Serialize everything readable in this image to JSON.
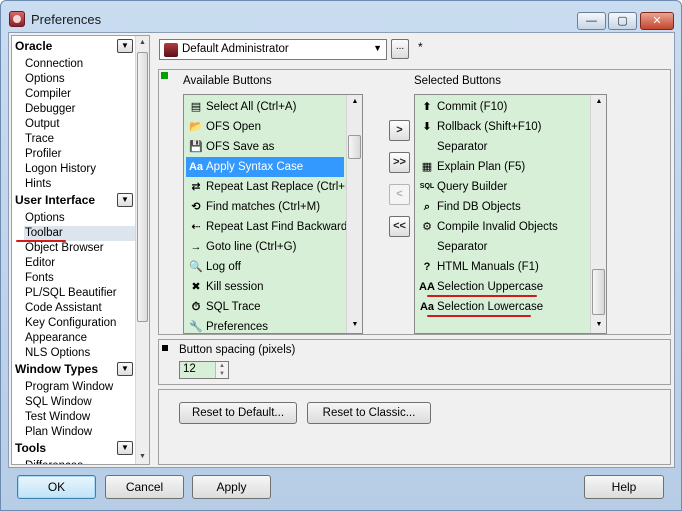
{
  "window": {
    "title": "Preferences",
    "min_glyph": "—",
    "max_glyph": "▢",
    "close_glyph": "✕"
  },
  "nav": {
    "groups": [
      {
        "label": "Oracle",
        "items": [
          "Connection",
          "Options",
          "Compiler",
          "Debugger",
          "Output",
          "Trace",
          "Profiler",
          "Logon History",
          "Hints"
        ]
      },
      {
        "label": "User Interface",
        "items": [
          "Options",
          "Toolbar",
          "Object Browser",
          "Editor",
          "Fonts",
          "PL/SQL Beautifier",
          "Code Assistant",
          "Key Configuration",
          "Appearance",
          "NLS Options"
        ]
      },
      {
        "label": "Window Types",
        "items": [
          "Program Window",
          "SQL Window",
          "Test Window",
          "Plan Window"
        ]
      },
      {
        "label": "Tools",
        "items": [
          "Differences"
        ]
      }
    ],
    "selected": "Toolbar"
  },
  "profile": {
    "value": "Default Administrator",
    "modified_marker": "*",
    "ellipsis": "..."
  },
  "toolbar_panel": {
    "available_label": "Available Buttons",
    "selected_label": "Selected Buttons",
    "available": [
      {
        "label": "Select All (Ctrl+A)",
        "icon": "page-icon",
        "glyph": "▤"
      },
      {
        "label": "OFS Open",
        "icon": "folder-open-icon",
        "glyph": "📂"
      },
      {
        "label": "OFS Save as",
        "icon": "floppy-icon",
        "glyph": "💾"
      },
      {
        "label": "Apply Syntax Case",
        "icon": "syntax-case-icon",
        "glyph": "Aa"
      },
      {
        "label": "Repeat Last Replace (Ctrl+P)",
        "icon": "replace-icon",
        "glyph": "⇄"
      },
      {
        "label": "Find matches (Ctrl+M)",
        "icon": "match-icon",
        "glyph": "⟲"
      },
      {
        "label": "Repeat Last Find Backwards (S",
        "icon": "find-back-icon",
        "glyph": "⇠"
      },
      {
        "label": "Goto line (Ctrl+G)",
        "icon": "goto-line-icon",
        "glyph": "→"
      },
      {
        "label": "Log off",
        "icon": "log-off-icon",
        "glyph": "🔍"
      },
      {
        "label": "Kill session",
        "icon": "kill-session-icon",
        "glyph": "✖"
      },
      {
        "label": "SQL Trace",
        "icon": "stopwatch-icon",
        "glyph": "⏱"
      },
      {
        "label": "Preferences",
        "icon": "wrench-icon",
        "glyph": "🔧"
      }
    ],
    "selected": [
      {
        "label": "Commit (F10)",
        "icon": "commit-icon",
        "glyph": "⬆"
      },
      {
        "label": "Rollback (Shift+F10)",
        "icon": "rollback-icon",
        "glyph": "⬇"
      },
      {
        "label": "Separator",
        "icon": "",
        "glyph": ""
      },
      {
        "label": "Explain Plan (F5)",
        "icon": "explain-plan-icon",
        "glyph": "▦"
      },
      {
        "label": "Query Builder",
        "icon": "query-builder-icon",
        "glyph": "SQL"
      },
      {
        "label": "Find DB Objects",
        "icon": "binoculars-icon",
        "glyph": "⌕"
      },
      {
        "label": "Compile Invalid Objects",
        "icon": "compile-icon",
        "glyph": "⚙"
      },
      {
        "label": "Separator",
        "icon": "",
        "glyph": ""
      },
      {
        "label": "HTML Manuals (F1)",
        "icon": "help-icon",
        "glyph": "?"
      },
      {
        "label": "Selection Uppercase",
        "icon": "uppercase-icon",
        "glyph": "AA"
      },
      {
        "label": "Selection Lowercase",
        "icon": "lowercase-icon",
        "glyph": "Aa"
      }
    ],
    "move_buttons": {
      "add": ">",
      "add_all": ">>",
      "remove": "<",
      "remove_all": "<<"
    }
  },
  "spacing": {
    "label": "Button spacing (pixels)",
    "value": "12"
  },
  "reset": {
    "default_label": "Reset to Default...",
    "classic_label": "Reset to Classic..."
  },
  "buttons": {
    "ok": "OK",
    "cancel": "Cancel",
    "apply": "Apply",
    "help": "Help"
  },
  "colors": {
    "list_bg": "#d7efd7",
    "selection": "#3399ff",
    "annotation": "#d11b1b",
    "marker": "#00a000"
  }
}
